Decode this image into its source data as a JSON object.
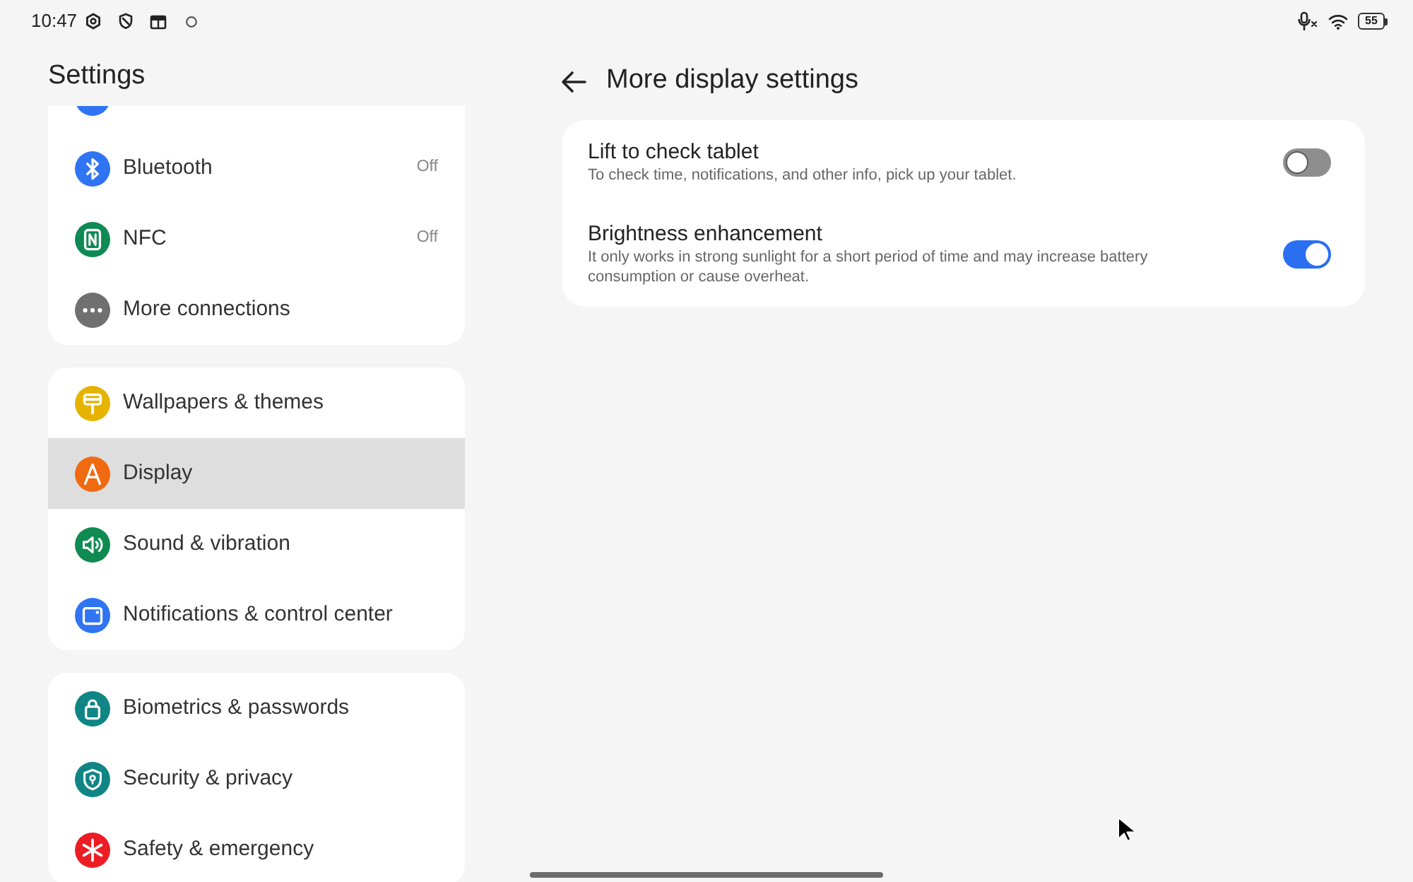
{
  "status_bar": {
    "time": "10:47",
    "battery": "55"
  },
  "sidebar": {
    "title": "Settings",
    "groups": [
      {
        "items": [
          {
            "color": "#2f74f2",
            "selected": false
          },
          {
            "label": "Bluetooth",
            "value": "Off",
            "color": "#2f74f2",
            "selected": false
          },
          {
            "label": "NFC",
            "value": "Off",
            "color": "#0e8a54",
            "selected": false
          },
          {
            "label": "More connections",
            "color": "#707070",
            "selected": false
          }
        ]
      },
      {
        "items": [
          {
            "label": "Wallpapers & themes",
            "color": "#e5b300",
            "selected": false
          },
          {
            "label": "Display",
            "color": "#f06a12",
            "selected": true
          },
          {
            "label": "Sound & vibration",
            "color": "#0f8a50",
            "selected": false
          },
          {
            "label": "Notifications & control center",
            "color": "#2f74f2",
            "selected": false
          }
        ]
      },
      {
        "items": [
          {
            "label": "Biometrics & passwords",
            "color": "#0f8585",
            "selected": false
          },
          {
            "label": "Security & privacy",
            "color": "#0f8585",
            "selected": false
          },
          {
            "label": "Safety & emergency",
            "color": "#ec1c24",
            "selected": false
          }
        ]
      }
    ]
  },
  "page": {
    "title": "More display settings",
    "settings": [
      {
        "title": "Lift to check tablet",
        "description": "To check time, notifications, and other info, pick up your tablet.",
        "on": false
      },
      {
        "title": "Brightness enhancement",
        "description": "It only works in strong sunlight for a short period of time and may increase battery consumption or cause overheat.",
        "on": true
      }
    ]
  }
}
